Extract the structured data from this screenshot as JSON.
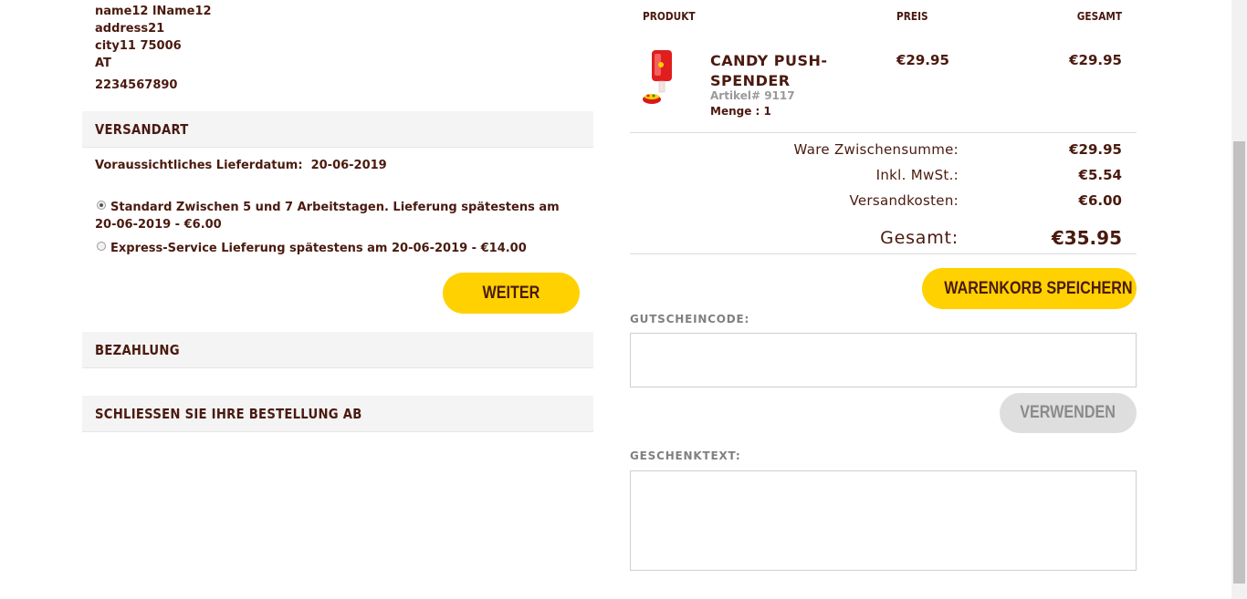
{
  "address": {
    "name": "name12 lName12",
    "street": "address21",
    "city": "city11 75006",
    "country": "AT",
    "phone": "2234567890"
  },
  "shipping": {
    "header": "VERSANDART",
    "delivery_label": "Voraussichtliches Lieferdatum:",
    "delivery_date": "20-06-2019",
    "options": [
      {
        "label": "Standard Zwischen 5 und 7 Arbeitstagen. Lieferung spätestens am 20-06-2019 - €6.00",
        "selected": true
      },
      {
        "label": "Express-Service Lieferung spätestens am 20-06-2019 - €14.00",
        "selected": false
      }
    ],
    "continue_label": "WEITER"
  },
  "payment": {
    "header": "BEZAHLUNG"
  },
  "complete": {
    "header": "SCHLIESSEN SIE IHRE BESTELLUNG AB"
  },
  "cart": {
    "columns": {
      "product": "PRODUKT",
      "price": "PREIS",
      "total": "GESAMT"
    },
    "item": {
      "name_line1": "CANDY PUSH-",
      "name_line2": "SPENDER",
      "article": "Artikel# 9117",
      "quantity": "Menge : 1",
      "price": "€29.95",
      "total": "€29.95",
      "image_icon": "candy-push-dispenser-image"
    },
    "summary": {
      "subtotal_label": "Ware Zwischensumme:",
      "subtotal": "€29.95",
      "vat_label": "Inkl. MwSt.:",
      "vat": "€5.54",
      "shipping_label": "Versandkosten:",
      "shipping": "€6.00",
      "total_label": "Gesamt:",
      "total": "€35.95"
    },
    "save_cart_label": "WARENKORB SPEICHERN",
    "voucher_label": "GUTSCHEINCODE:",
    "voucher_value": "",
    "apply_label": "VERWENDEN",
    "gift_label": "GESCHENKTEXT:",
    "gift_value": ""
  },
  "colors": {
    "accent": "#ffd100",
    "text": "#4a1a0f",
    "header_bg": "#f4f4f4",
    "disabled_button": "#dedede"
  }
}
